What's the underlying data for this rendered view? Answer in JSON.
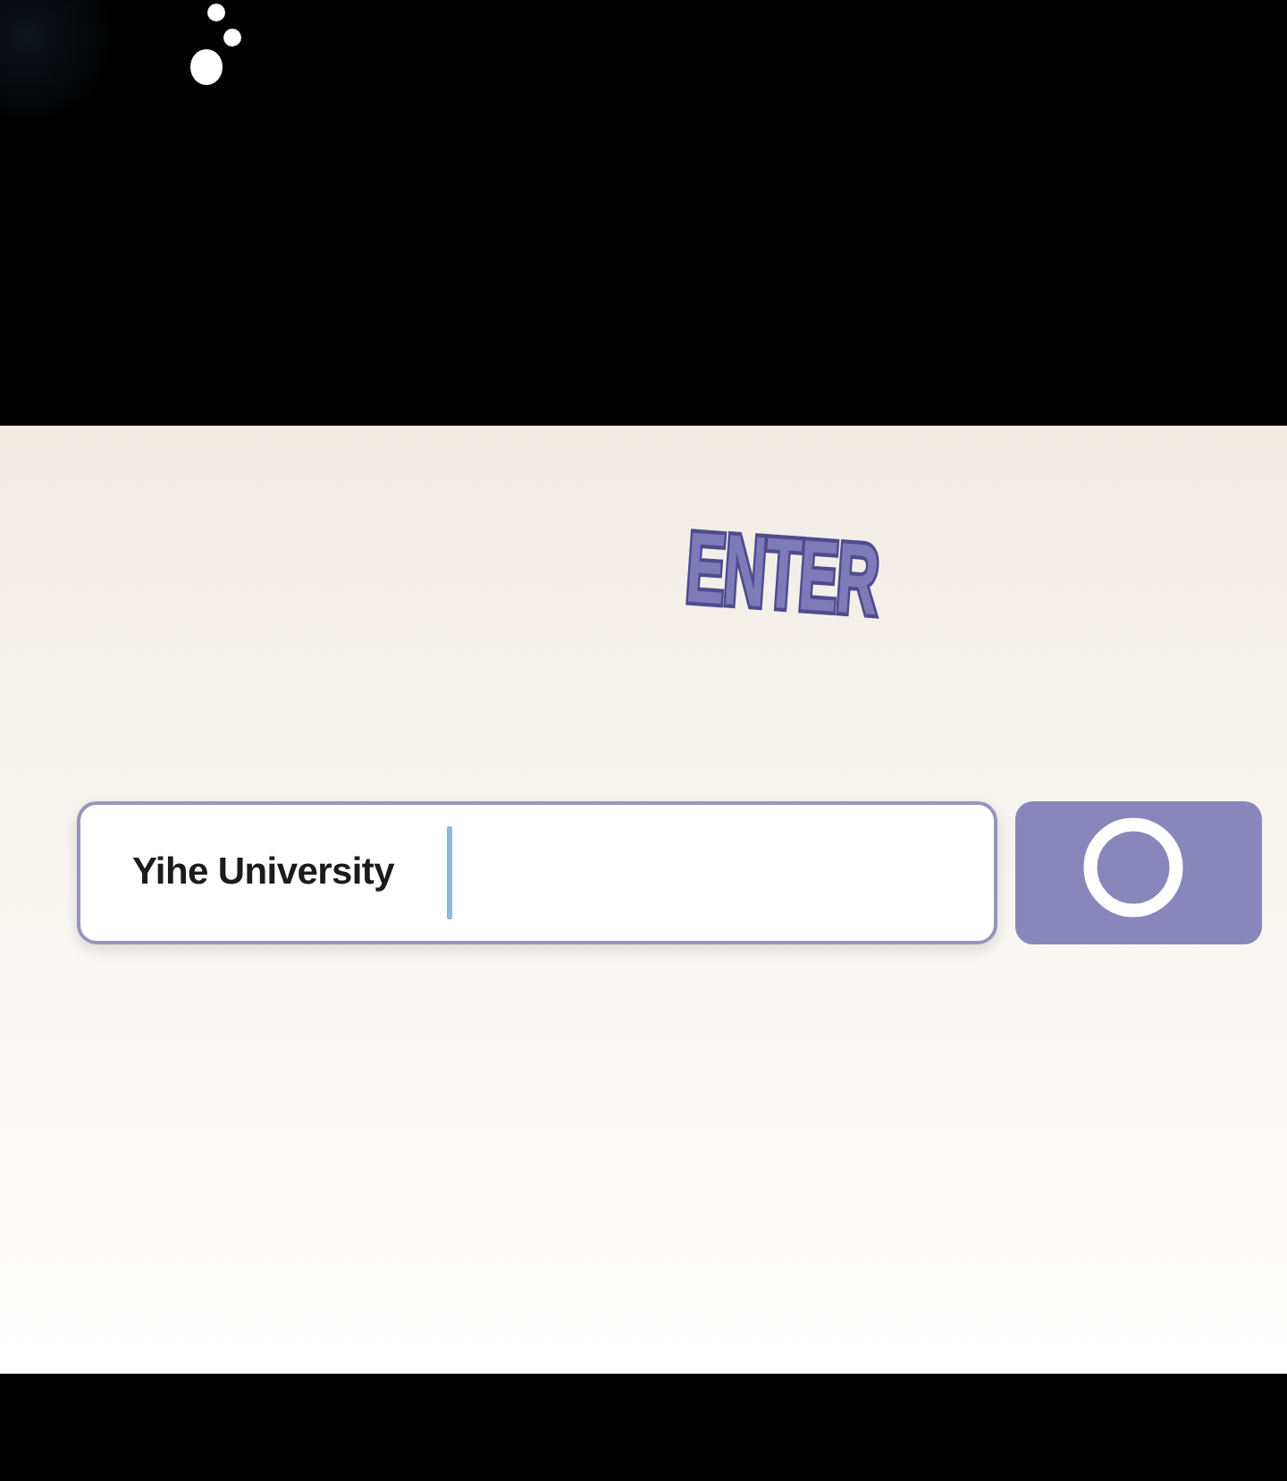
{
  "sound_effect": {
    "text": "ENTER"
  },
  "search": {
    "value": "Yihe University",
    "focused": true
  }
}
